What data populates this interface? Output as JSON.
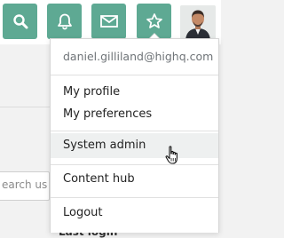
{
  "topbar": {
    "icons": [
      "search-icon",
      "bell-icon",
      "mail-icon",
      "star-icon"
    ],
    "accent_color": "#5ea993"
  },
  "background": {
    "search_placeholder": "earch use",
    "bottom_fragment": "Last login"
  },
  "user_menu": {
    "email": "daniel.gilliland@highq.com",
    "items": [
      {
        "label": "My profile"
      },
      {
        "label": "My preferences"
      },
      {
        "label": "System admin"
      },
      {
        "label": "Content hub"
      },
      {
        "label": "Logout"
      }
    ]
  }
}
